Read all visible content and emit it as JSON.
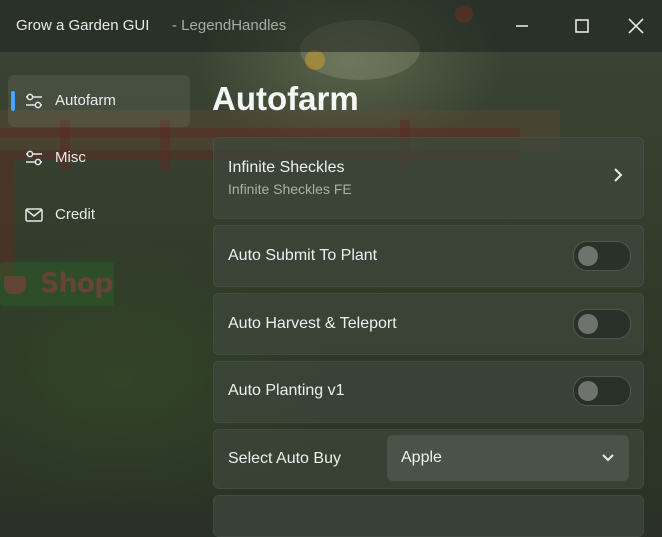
{
  "window": {
    "title": "Grow a Garden GUI",
    "subtitle": "- LegendHandles"
  },
  "controls": {
    "minimize_icon": "minimize-icon",
    "maximize_icon": "maximize-icon",
    "close_icon": "close-icon"
  },
  "sidebar": {
    "items": [
      {
        "label": "Autofarm",
        "icon": "sliders-icon",
        "active": true
      },
      {
        "label": "Misc",
        "icon": "sliders-icon",
        "active": false
      },
      {
        "label": "Credit",
        "icon": "mail-icon",
        "active": false
      }
    ]
  },
  "background": {
    "shop_sign": "Shop"
  },
  "content": {
    "page_title": "Autofarm",
    "button_card": {
      "title": "Infinite Sheckles",
      "description": "Infinite Sheckles FE"
    },
    "toggles": [
      {
        "label": "Auto Submit To Plant",
        "enabled": false
      },
      {
        "label": "Auto Harvest & Teleport",
        "enabled": false
      },
      {
        "label": "Auto Planting v1",
        "enabled": false
      }
    ],
    "dropdown": {
      "label": "Select Auto Buy",
      "value": "Apple"
    }
  },
  "colors": {
    "accent": "#4aa3ff",
    "card_bg": "#3e463c",
    "text": "#ececec",
    "subtext": "#a9b0a6"
  }
}
